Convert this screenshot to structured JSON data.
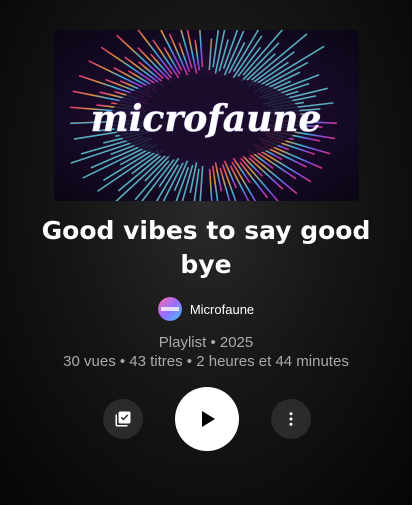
{
  "playlist": {
    "cover_text": "microfaune",
    "title": "Good vibes to say good bye",
    "artist": "Microfaune",
    "type_year": "Playlist • 2025",
    "stats": "30 vues • 43 titres • 2 heures et 44 minutes"
  },
  "actions": {
    "save_icon": "library-add-check-icon",
    "play_icon": "play-icon",
    "more_icon": "more-vertical-icon"
  },
  "colors": {
    "background": "#0d0d0d",
    "title": "#ffffff",
    "meta": "#aaaaaa",
    "play_button": "#ffffff",
    "secondary_button": "#2b2b2b"
  }
}
